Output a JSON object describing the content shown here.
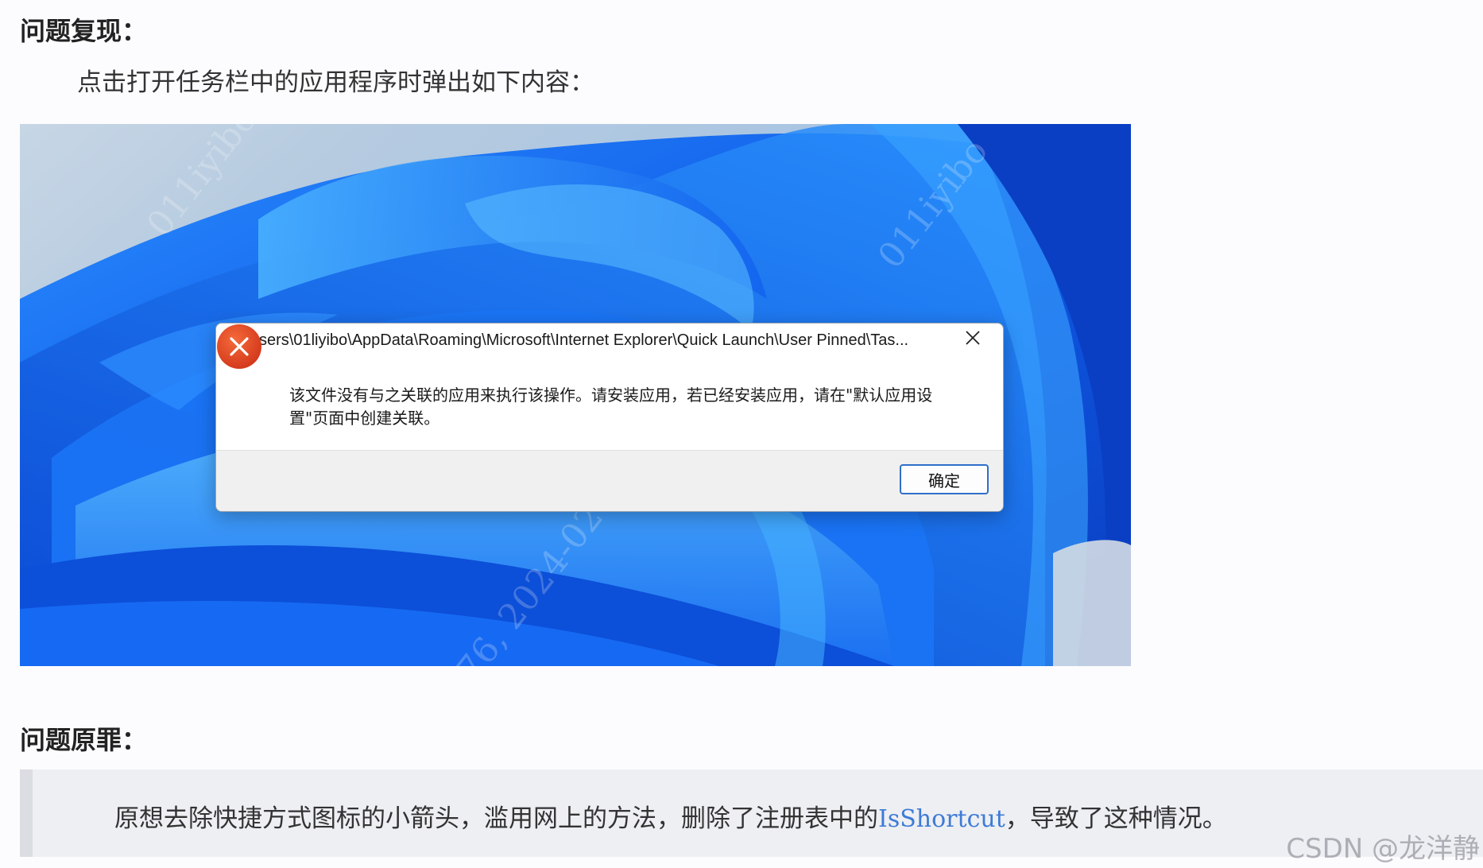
{
  "section_issue": {
    "heading": "问题复现："
  },
  "intro_text": "点击打开任务栏中的应用程序时弹出如下内容：",
  "screenshot": {
    "watermarks": [
      "011iyibo",
      "011iyibo",
      "76, 2024-02-02"
    ]
  },
  "dialog": {
    "title": "C:\\Users\\01liyibo\\AppData\\Roaming\\Microsoft\\Internet Explorer\\Quick Launch\\User Pinned\\Tas...",
    "close_icon": "close-icon",
    "error_icon": "error-x-icon",
    "message_line1": "该文件没有与之关联的应用来执行该操作。请安装应用，若已经安装应用，请在\"默认应用设",
    "message_line2": "置\"页面中创建关联。",
    "ok_label": "确定",
    "error_color": "#e0421c",
    "ok_border_color": "#2f6fc9"
  },
  "section_cause": {
    "heading": "问题原罪："
  },
  "cause": {
    "text_before": "原想去除快捷方式图标的小箭头，滥用网上的方法，删除了注册表中的",
    "code": "IsShortcut",
    "text_after": "，导致了这种情况。"
  },
  "watermark_csdn": "CSDN @龙洋静",
  "colors": {
    "wallpaper_blue": "#1565ea",
    "link_code": "#3d7bd6"
  }
}
